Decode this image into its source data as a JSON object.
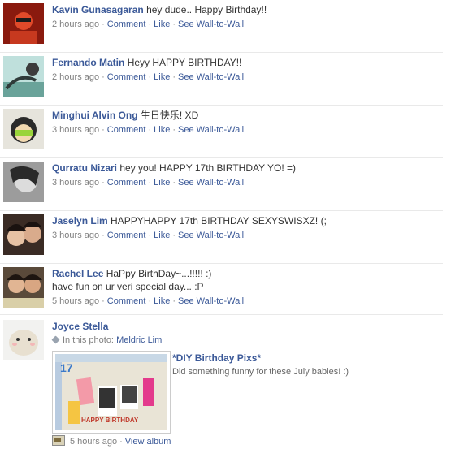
{
  "posts": [
    {
      "author": "Kavin Gunasagaran",
      "message": "hey dude.. Happy Birthday!!",
      "time": "2 hours ago",
      "comment": "Comment",
      "like": "Like",
      "wall": "See Wall-to-Wall"
    },
    {
      "author": "Fernando Matin",
      "message": "Heyy HAPPY BIRTHDAY!!",
      "time": "2 hours ago",
      "comment": "Comment",
      "like": "Like",
      "wall": "See Wall-to-Wall"
    },
    {
      "author": "Minghui Alvin Ong",
      "message": "生日快乐! XD",
      "time": "3 hours ago",
      "comment": "Comment",
      "like": "Like",
      "wall": "See Wall-to-Wall"
    },
    {
      "author": "Qurratu Nizari",
      "message": "hey you! HAPPY 17th BIRTHDAY YO! =)",
      "time": "3 hours ago",
      "comment": "Comment",
      "like": "Like",
      "wall": "See Wall-to-Wall"
    },
    {
      "author": "Jaselyn Lim",
      "message": "HAPPYHAPPY 17th BIRTHDAY SEXYSWISXZ! (;",
      "time": "3 hours ago",
      "comment": "Comment",
      "like": "Like",
      "wall": "See Wall-to-Wall"
    },
    {
      "author": "Rachel Lee",
      "message": "HaPpy BirthDay~...!!!!! :)",
      "message2": "have fun on ur veri special day... :P",
      "time": "5 hours ago",
      "comment": "Comment",
      "like": "Like",
      "wall": "See Wall-to-Wall"
    }
  ],
  "album_post": {
    "author": "Joyce Stella",
    "in_photo_label": "In this photo:",
    "tagged": "Meldric Lim",
    "album_title": "*DIY Birthday Pixs*",
    "album_desc": "Did something funny for these July babies! :)",
    "time": "5 hours ago",
    "view_album": "View album",
    "photo_text_top": "17",
    "photo_text_bottom": "HAPPY BIRTHDAY"
  },
  "separator": "·",
  "colors": {
    "link": "#3b5998",
    "meta": "#808080",
    "divider": "#e9e9e9"
  }
}
